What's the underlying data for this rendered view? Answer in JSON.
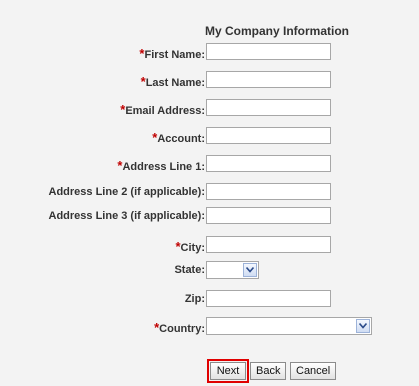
{
  "form": {
    "title": "My  Company Information",
    "required_mark": "*",
    "fields": [
      {
        "label": "First Name:",
        "required": true
      },
      {
        "label": "Last Name:",
        "required": true
      },
      {
        "label": "Email Address:",
        "required": true
      },
      {
        "label": "Account:",
        "required": true
      },
      {
        "label": "Address Line 1:",
        "required": true
      },
      {
        "label": "Address Line 2 (if applicable):",
        "required": false
      },
      {
        "label": "Address Line 3 (if applicable):",
        "required": false
      },
      {
        "label": "City:",
        "required": true
      },
      {
        "label": "State:",
        "required": false
      },
      {
        "label": "Zip:",
        "required": false
      },
      {
        "label": "Country:",
        "required": true
      }
    ]
  },
  "buttons": {
    "next": "Next",
    "back": "Back",
    "cancel": "Cancel"
  },
  "colors": {
    "required": "#c00000",
    "highlight": "#e00000"
  },
  "icons": {
    "dropdown": "chevron-down-icon"
  }
}
